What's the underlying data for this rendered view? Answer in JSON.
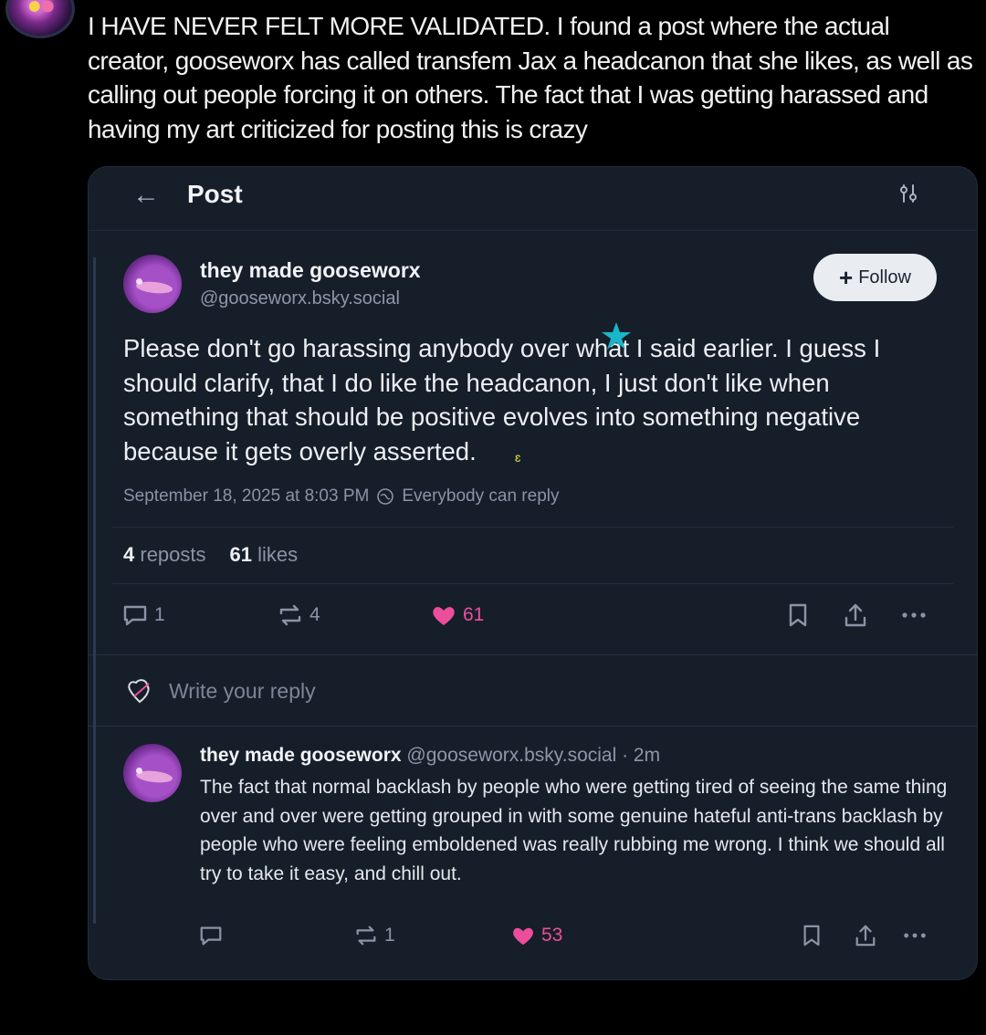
{
  "outer_post": {
    "text": "I HAVE NEVER FELT MORE VALIDATED. I found a post where the actual creator, gooseworx has called transfem Jax a headcanon that she likes, as well as calling out people forcing it on others. The fact that I was getting harassed and having my art criticized for posting this is crazy"
  },
  "screenshot": {
    "header": {
      "title": "Post"
    },
    "main_post": {
      "display_name": "they made gooseworx",
      "handle": "@gooseworx.bsky.social",
      "follow_label": "Follow",
      "text": "Please don't go harassing anybody over what I said earlier. I guess I should clarify, that I do like the headcanon, I just don't like when something that should be positive evolves into something negative because it gets overly asserted.",
      "timestamp": "September 18, 2025 at 8:03 PM",
      "reply_setting": "Everybody can reply",
      "reposts_count": "4",
      "reposts_label": "reposts",
      "likes_count": "61",
      "likes_label": "likes",
      "actions": {
        "replies": "1",
        "reposts": "4",
        "likes": "61"
      }
    },
    "reply_placeholder": "Write your reply",
    "reply": {
      "display_name": "they made gooseworx",
      "handle": "@gooseworx.bsky.social",
      "time": "· 2m",
      "text": "The fact that normal backlash by people who were getting tired of seeing the same thing over and over were getting grouped in with some genuine hateful anti-trans backlash by people who were feeling emboldened was really rubbing me wrong. I think we should all try to take it easy, and chill out.",
      "actions": {
        "replies": "",
        "reposts": "1",
        "likes": "53"
      }
    }
  },
  "colors": {
    "background": "#000000",
    "card": "#161e29",
    "like_pink": "#ec4e9c",
    "muted_text": "#8a94a5"
  }
}
